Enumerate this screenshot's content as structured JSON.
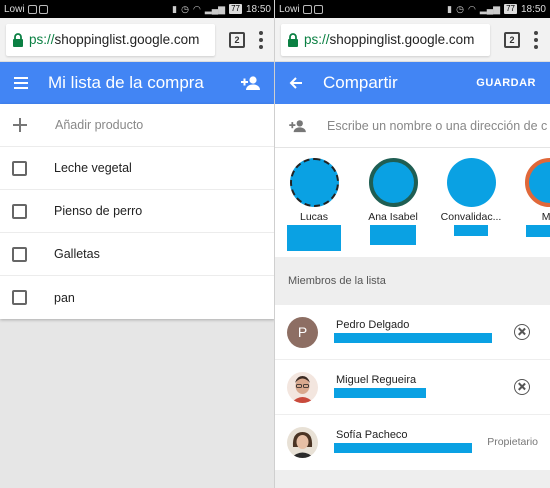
{
  "left": {
    "status": {
      "carrier": "Lowi",
      "time": "18:50",
      "battery": "77"
    },
    "browser": {
      "url_scheme": "ps://",
      "url_host": "shoppinglist.google.com",
      "tab_count": "2"
    },
    "appbar": {
      "title": "Mi lista de la compra"
    },
    "list": {
      "add_label": "Añadir producto",
      "items": [
        {
          "label": "Leche vegetal",
          "checked": false
        },
        {
          "label": "Pienso de perro",
          "checked": false
        },
        {
          "label": "Galletas",
          "checked": false
        },
        {
          "label": "pan",
          "checked": false
        }
      ]
    }
  },
  "right": {
    "status": {
      "carrier": "Lowi",
      "time": "18:50",
      "battery": "77"
    },
    "browser": {
      "url_scheme": "ps://",
      "url_host": "shoppinglist.google.com",
      "tab_count": "2"
    },
    "appbar": {
      "title": "Compartir",
      "save_label": "GUARDAR"
    },
    "share": {
      "placeholder": "Escribe un nombre o una dirección de c",
      "contacts": [
        {
          "name": "Lucas",
          "ring": "dashed"
        },
        {
          "name": "Ana Isabel",
          "ring": "#1f5e53"
        },
        {
          "name": "Convalidac...",
          "ring": "none"
        },
        {
          "name": "Ma",
          "ring": "#e0683a"
        }
      ]
    },
    "members": {
      "header": "Miembros de la lista",
      "items": [
        {
          "name": "Pedro Delgado",
          "avatar_letter": "P",
          "role": ""
        },
        {
          "name": "Miguel Regueira",
          "avatar_letter": "",
          "role": ""
        },
        {
          "name": "Sofía Pacheco",
          "avatar_letter": "",
          "role": "Propietario"
        }
      ]
    }
  },
  "colors": {
    "appbar": "#4285f4",
    "redaction": "#0aa1e3",
    "secure": "#0b8043"
  },
  "icons": [
    "hamburger-icon",
    "add-person-icon",
    "back-arrow-icon",
    "plus-icon",
    "lock-icon",
    "remove-icon"
  ]
}
